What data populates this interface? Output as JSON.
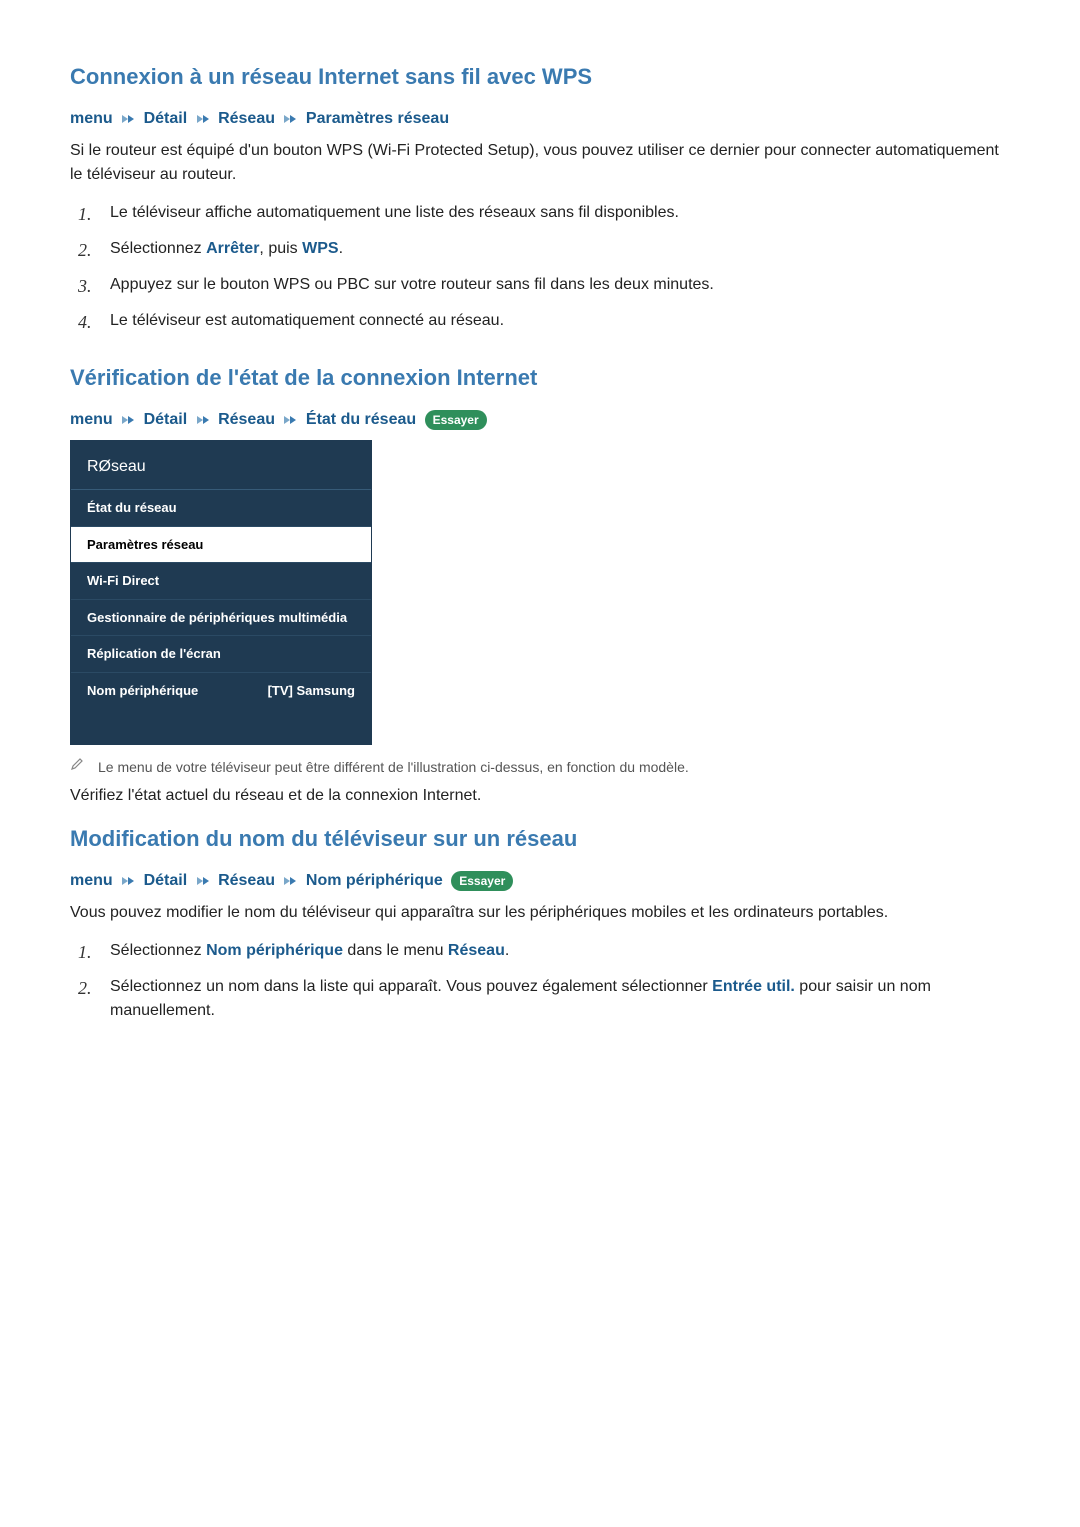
{
  "section1": {
    "title": "Connexion à un réseau Internet sans fil avec WPS",
    "breadcrumb": [
      "menu",
      "Détail",
      "Réseau",
      "Paramètres réseau"
    ],
    "intro": "Si le routeur est équipé d'un bouton WPS (Wi-Fi Protected Setup), vous pouvez utiliser ce dernier pour connecter automatiquement le téléviseur au routeur.",
    "step1": "Le téléviseur affiche automatiquement une liste des réseaux sans fil disponibles.",
    "step2_a": "Sélectionnez ",
    "step2_kw1": "Arrêter",
    "step2_b": ", puis ",
    "step2_kw2": "WPS",
    "step2_c": ".",
    "step3": "Appuyez sur le bouton WPS ou PBC sur votre routeur sans fil dans les deux minutes.",
    "step4": "Le téléviseur est automatiquement connecté au réseau."
  },
  "section2": {
    "title": "Vérification de l'état de la connexion Internet",
    "breadcrumb": [
      "menu",
      "Détail",
      "Réseau",
      "État du réseau"
    ],
    "try_label": "Essayer",
    "tv_menu": {
      "title": "RØseau",
      "items": [
        {
          "label": "État du réseau",
          "value": ""
        },
        {
          "label": "Paramètres réseau",
          "value": ""
        },
        {
          "label": "Wi-Fi Direct",
          "value": ""
        },
        {
          "label": "Gestionnaire de périphériques multimédia",
          "value": ""
        },
        {
          "label": "Réplication de l'écran",
          "value": ""
        },
        {
          "label": "Nom périphérique",
          "value": "[TV] Samsung"
        }
      ]
    },
    "note": "Le menu de votre téléviseur peut être différent de l'illustration ci-dessus, en fonction du modèle.",
    "body": "Vérifiez l'état actuel du réseau et de la connexion Internet."
  },
  "section3": {
    "title": "Modification du nom du téléviseur sur un réseau",
    "breadcrumb": [
      "menu",
      "Détail",
      "Réseau",
      "Nom périphérique"
    ],
    "try_label": "Essayer",
    "intro": "Vous pouvez modifier le nom du téléviseur qui apparaîtra sur les périphériques mobiles et les ordinateurs portables.",
    "step1_a": "Sélectionnez ",
    "step1_kw1": "Nom périphérique",
    "step1_b": " dans le menu ",
    "step1_kw2": "Réseau",
    "step1_c": ".",
    "step2_a": "Sélectionnez un nom dans la liste qui apparaît. Vous pouvez également sélectionner ",
    "step2_kw1": "Entrée util.",
    "step2_b": " pour saisir un nom manuellement."
  }
}
